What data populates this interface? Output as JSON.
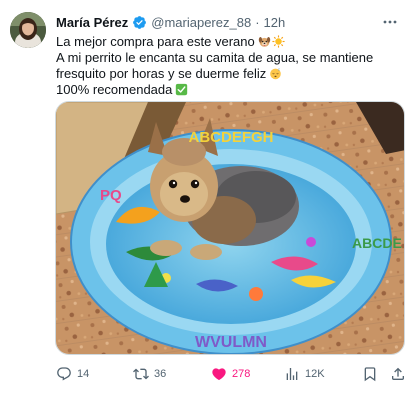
{
  "tweet": {
    "author_name": "María Pérez",
    "handle": "@mariaperez_88",
    "separator": "·",
    "time": "12h",
    "text_lines": [
      "La mejor compra para este verano",
      "A mi perrito le encanta su camita de agua, se mantiene",
      "fresquito por horas y se duerme feliz",
      "100% recomendada"
    ],
    "icons": {
      "verified": "verified-badge-icon",
      "more": "more-icon",
      "emoji_1": "dog-face-emoji",
      "emoji_2": "sun-emoji",
      "emoji_3": "sleeping-face-emoji",
      "emoji_4": "check-mark-emoji"
    },
    "media": {
      "bed_letters_top": "ABCDEFGH",
      "bed_letters_left": "PQ",
      "bed_letters_bottom": "WVULMN",
      "bed_letters_right": "ABCDE"
    },
    "actions": {
      "replies": "14",
      "reposts": "36",
      "likes": "278",
      "views": "12K"
    },
    "colors": {
      "accent": "#1d9bf0",
      "like": "#f91880",
      "meta": "#536471"
    }
  }
}
